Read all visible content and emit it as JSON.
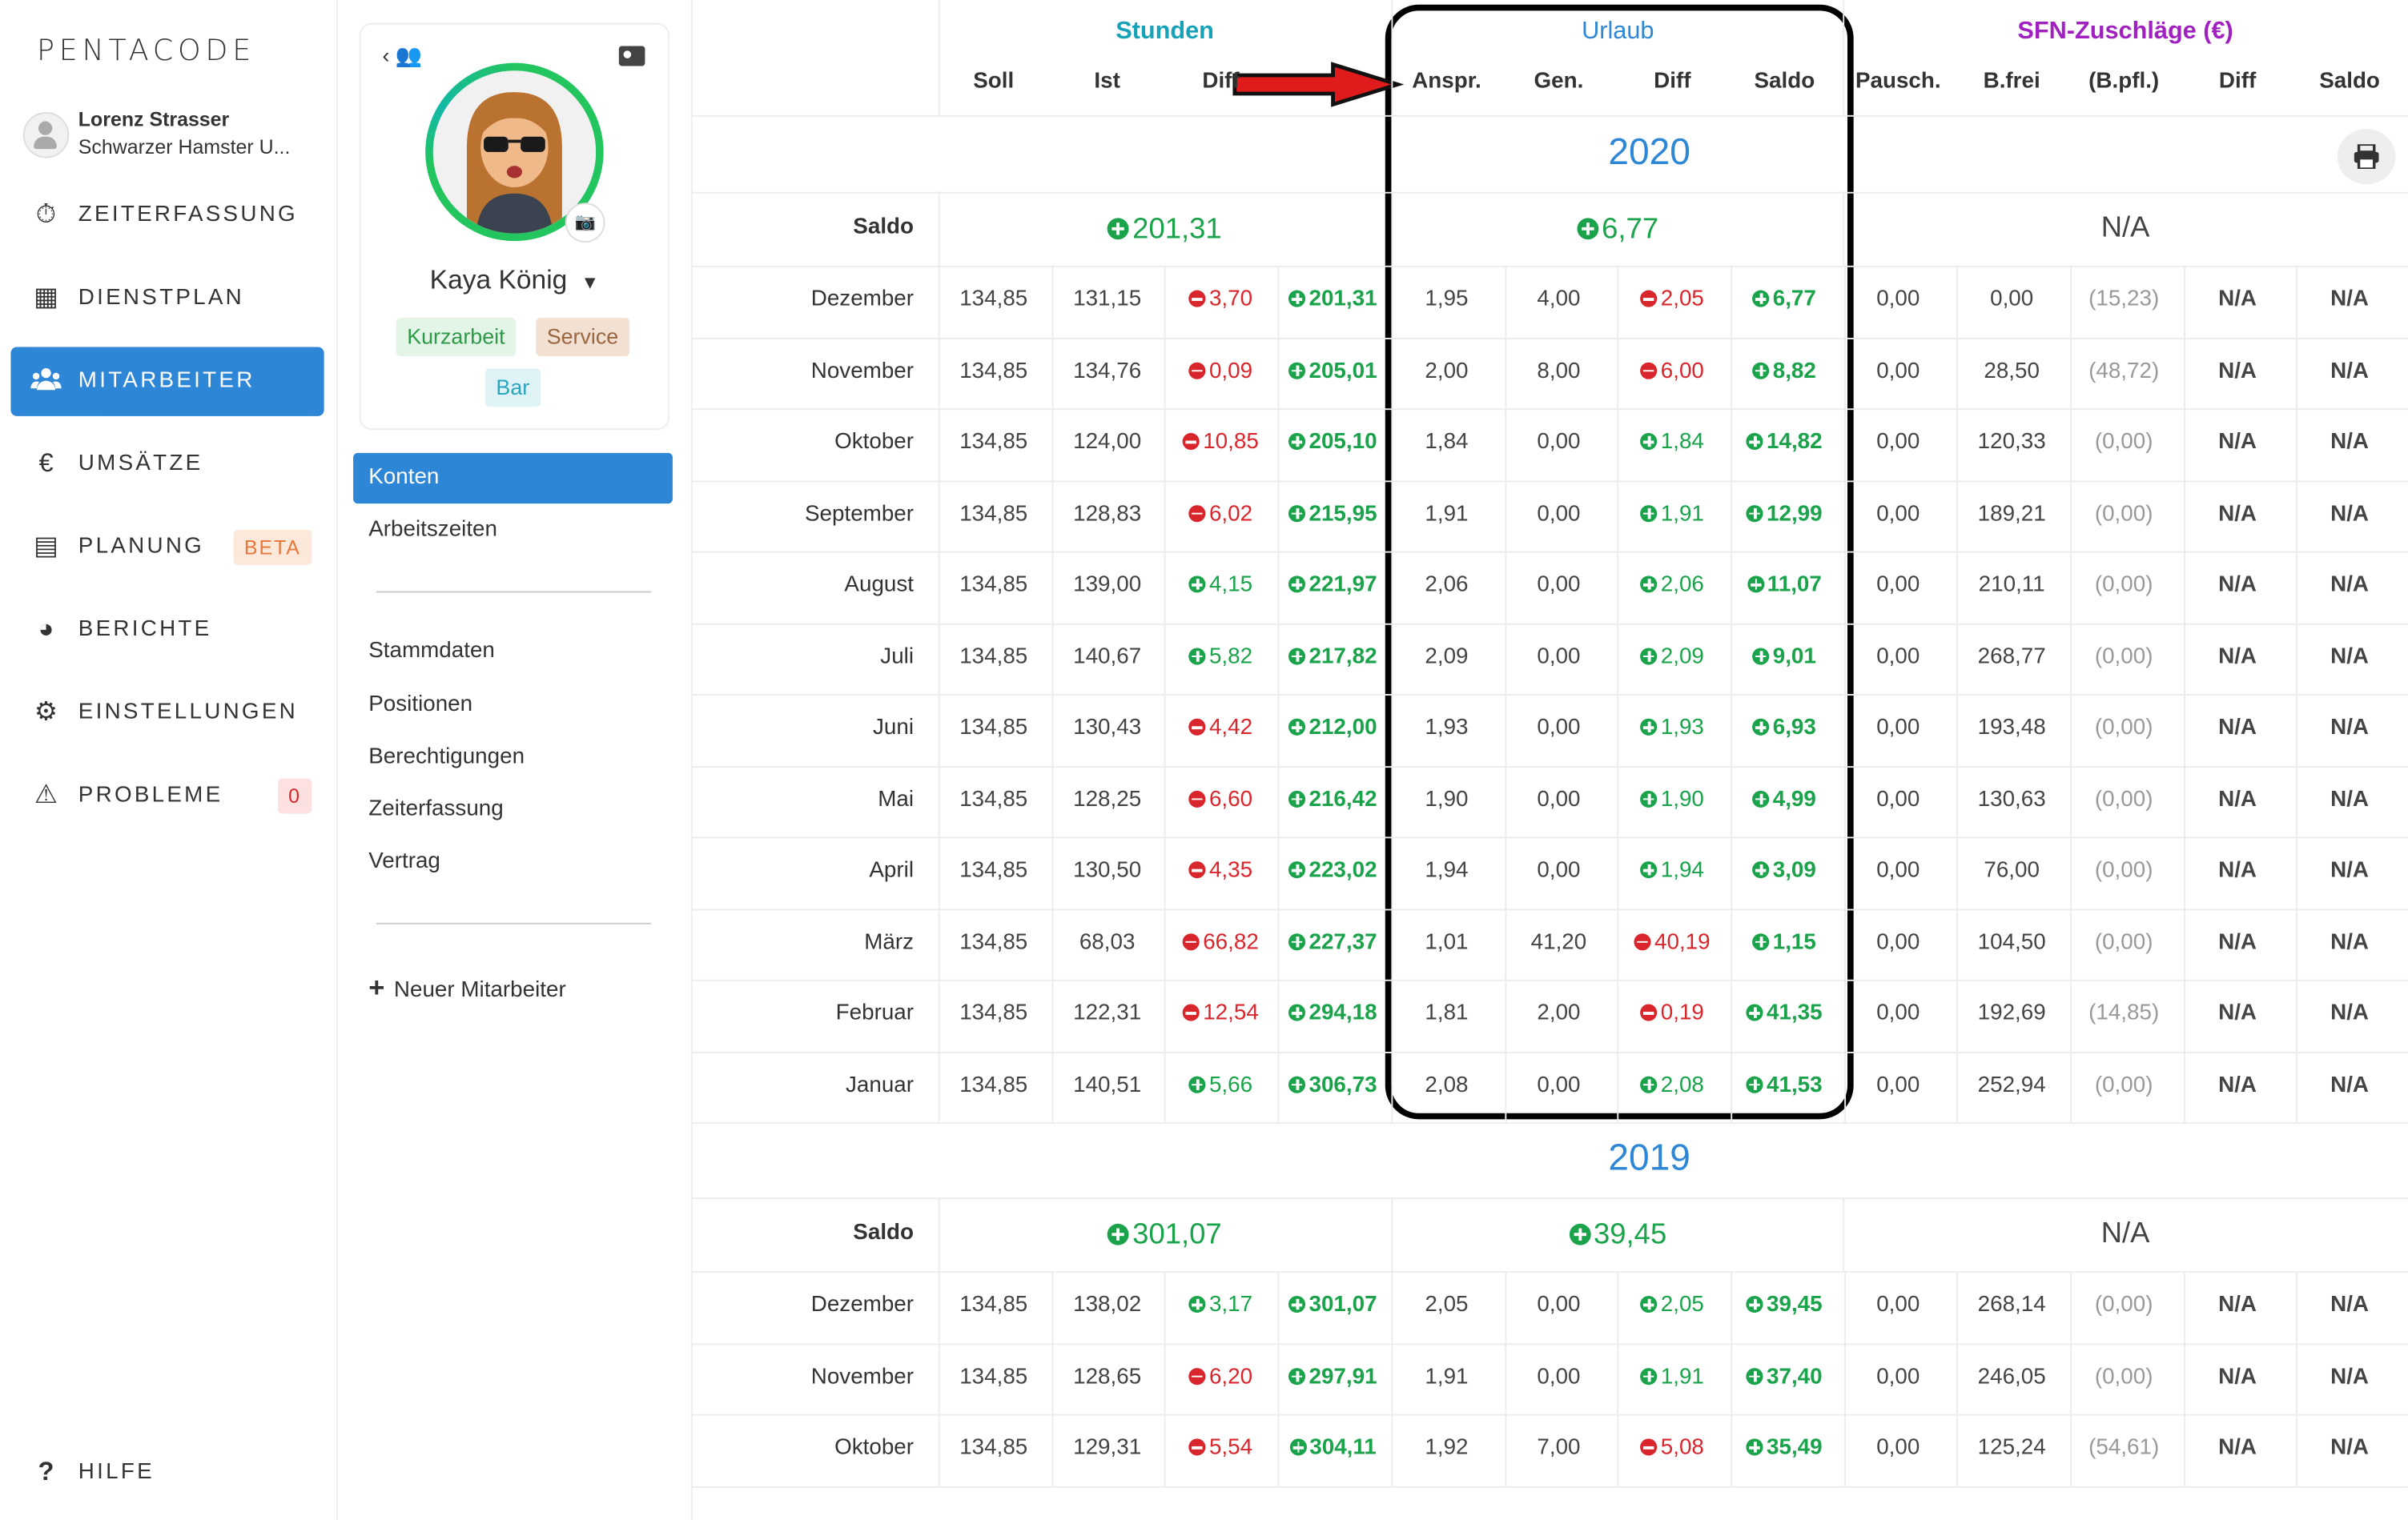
{
  "app": {
    "logo": "PENTACODE"
  },
  "user": {
    "name": "Lorenz Strasser",
    "company": "Schwarzer Hamster U..."
  },
  "nav": {
    "items": [
      {
        "label": "ZEITERFASSUNG",
        "icon": "stopwatch-icon"
      },
      {
        "label": "DIENSTPLAN",
        "icon": "table-icon"
      },
      {
        "label": "MITARBEITER",
        "icon": "users-icon",
        "active": true
      },
      {
        "label": "UMSÄTZE",
        "icon": "euro-icon"
      },
      {
        "label": "PLANUNG",
        "icon": "calendar-icon",
        "badge": "BETA"
      },
      {
        "label": "BERICHTE",
        "icon": "pie-chart-icon"
      },
      {
        "label": "EINSTELLUNGEN",
        "icon": "gear-icon"
      },
      {
        "label": "PROBLEME",
        "icon": "warning-icon",
        "badge": "0"
      }
    ],
    "help": "HILFE"
  },
  "profile": {
    "name": "Kaya König",
    "tags": [
      "Kurzarbeit",
      "Service",
      "Bar"
    ],
    "subnav_top": [
      "Konten",
      "Arbeitszeiten"
    ],
    "subnav_mid": [
      "Stammdaten",
      "Positionen",
      "Berechtigungen",
      "Zeiterfassung",
      "Vertrag"
    ],
    "new_employee": "Neuer Mitarbeiter"
  },
  "table": {
    "groups": {
      "stunden": "Stunden",
      "urlaub": "Urlaub",
      "sfn": "SFN-Zuschläge (€)"
    },
    "headers": [
      "Soll",
      "Ist",
      "Diff",
      "Anspr.",
      "Gen.",
      "Diff",
      "Saldo",
      "Pausch.",
      "B.frei",
      "(B.pfl.)",
      "Diff",
      "Saldo"
    ],
    "saldo_label": "Saldo",
    "years": [
      {
        "year": "2020",
        "saldo_stunden": "201,31",
        "saldo_urlaub": "6,77",
        "saldo_sfn": "N/A",
        "rows": [
          {
            "month": "Dezember",
            "soll": "134,85",
            "ist": "131,15",
            "diff": "3,70",
            "diff_sign": "n",
            "saldo": "201,31",
            "anspr": "1,95",
            "gen": "4,00",
            "udiff": "2,05",
            "udiff_sign": "n",
            "usaldo": "6,77",
            "pausch": "0,00",
            "bfrei": "0,00",
            "bpfl": "(15,23)",
            "sdiff": "N/A",
            "ssaldo": "N/A"
          },
          {
            "month": "November",
            "soll": "134,85",
            "ist": "134,76",
            "diff": "0,09",
            "diff_sign": "n",
            "saldo": "205,01",
            "anspr": "2,00",
            "gen": "8,00",
            "udiff": "6,00",
            "udiff_sign": "n",
            "usaldo": "8,82",
            "pausch": "0,00",
            "bfrei": "28,50",
            "bpfl": "(48,72)",
            "sdiff": "N/A",
            "ssaldo": "N/A"
          },
          {
            "month": "Oktober",
            "soll": "134,85",
            "ist": "124,00",
            "diff": "10,85",
            "diff_sign": "n",
            "saldo": "205,10",
            "anspr": "1,84",
            "gen": "0,00",
            "udiff": "1,84",
            "udiff_sign": "p",
            "usaldo": "14,82",
            "pausch": "0,00",
            "bfrei": "120,33",
            "bpfl": "(0,00)",
            "sdiff": "N/A",
            "ssaldo": "N/A"
          },
          {
            "month": "September",
            "soll": "134,85",
            "ist": "128,83",
            "diff": "6,02",
            "diff_sign": "n",
            "saldo": "215,95",
            "anspr": "1,91",
            "gen": "0,00",
            "udiff": "1,91",
            "udiff_sign": "p",
            "usaldo": "12,99",
            "pausch": "0,00",
            "bfrei": "189,21",
            "bpfl": "(0,00)",
            "sdiff": "N/A",
            "ssaldo": "N/A"
          },
          {
            "month": "August",
            "soll": "134,85",
            "ist": "139,00",
            "diff": "4,15",
            "diff_sign": "p",
            "saldo": "221,97",
            "anspr": "2,06",
            "gen": "0,00",
            "udiff": "2,06",
            "udiff_sign": "p",
            "usaldo": "11,07",
            "pausch": "0,00",
            "bfrei": "210,11",
            "bpfl": "(0,00)",
            "sdiff": "N/A",
            "ssaldo": "N/A"
          },
          {
            "month": "Juli",
            "soll": "134,85",
            "ist": "140,67",
            "diff": "5,82",
            "diff_sign": "p",
            "saldo": "217,82",
            "anspr": "2,09",
            "gen": "0,00",
            "udiff": "2,09",
            "udiff_sign": "p",
            "usaldo": "9,01",
            "pausch": "0,00",
            "bfrei": "268,77",
            "bpfl": "(0,00)",
            "sdiff": "N/A",
            "ssaldo": "N/A"
          },
          {
            "month": "Juni",
            "soll": "134,85",
            "ist": "130,43",
            "diff": "4,42",
            "diff_sign": "n",
            "saldo": "212,00",
            "anspr": "1,93",
            "gen": "0,00",
            "udiff": "1,93",
            "udiff_sign": "p",
            "usaldo": "6,93",
            "pausch": "0,00",
            "bfrei": "193,48",
            "bpfl": "(0,00)",
            "sdiff": "N/A",
            "ssaldo": "N/A"
          },
          {
            "month": "Mai",
            "soll": "134,85",
            "ist": "128,25",
            "diff": "6,60",
            "diff_sign": "n",
            "saldo": "216,42",
            "anspr": "1,90",
            "gen": "0,00",
            "udiff": "1,90",
            "udiff_sign": "p",
            "usaldo": "4,99",
            "pausch": "0,00",
            "bfrei": "130,63",
            "bpfl": "(0,00)",
            "sdiff": "N/A",
            "ssaldo": "N/A"
          },
          {
            "month": "April",
            "soll": "134,85",
            "ist": "130,50",
            "diff": "4,35",
            "diff_sign": "n",
            "saldo": "223,02",
            "anspr": "1,94",
            "gen": "0,00",
            "udiff": "1,94",
            "udiff_sign": "p",
            "usaldo": "3,09",
            "pausch": "0,00",
            "bfrei": "76,00",
            "bpfl": "(0,00)",
            "sdiff": "N/A",
            "ssaldo": "N/A"
          },
          {
            "month": "März",
            "soll": "134,85",
            "ist": "68,03",
            "diff": "66,82",
            "diff_sign": "n",
            "saldo": "227,37",
            "anspr": "1,01",
            "gen": "41,20",
            "udiff": "40,19",
            "udiff_sign": "n",
            "usaldo": "1,15",
            "pausch": "0,00",
            "bfrei": "104,50",
            "bpfl": "(0,00)",
            "sdiff": "N/A",
            "ssaldo": "N/A"
          },
          {
            "month": "Februar",
            "soll": "134,85",
            "ist": "122,31",
            "diff": "12,54",
            "diff_sign": "n",
            "saldo": "294,18",
            "anspr": "1,81",
            "gen": "2,00",
            "udiff": "0,19",
            "udiff_sign": "n",
            "usaldo": "41,35",
            "pausch": "0,00",
            "bfrei": "192,69",
            "bpfl": "(14,85)",
            "sdiff": "N/A",
            "ssaldo": "N/A"
          },
          {
            "month": "Januar",
            "soll": "134,85",
            "ist": "140,51",
            "diff": "5,66",
            "diff_sign": "p",
            "saldo": "306,73",
            "anspr": "2,08",
            "gen": "0,00",
            "udiff": "2,08",
            "udiff_sign": "p",
            "usaldo": "41,53",
            "pausch": "0,00",
            "bfrei": "252,94",
            "bpfl": "(0,00)",
            "sdiff": "N/A",
            "ssaldo": "N/A"
          }
        ]
      },
      {
        "year": "2019",
        "saldo_stunden": "301,07",
        "saldo_urlaub": "39,45",
        "saldo_sfn": "N/A",
        "rows": [
          {
            "month": "Dezember",
            "soll": "134,85",
            "ist": "138,02",
            "diff": "3,17",
            "diff_sign": "p",
            "saldo": "301,07",
            "anspr": "2,05",
            "gen": "0,00",
            "udiff": "2,05",
            "udiff_sign": "p",
            "usaldo": "39,45",
            "pausch": "0,00",
            "bfrei": "268,14",
            "bpfl": "(0,00)",
            "sdiff": "N/A",
            "ssaldo": "N/A"
          },
          {
            "month": "November",
            "soll": "134,85",
            "ist": "128,65",
            "diff": "6,20",
            "diff_sign": "n",
            "saldo": "297,91",
            "anspr": "1,91",
            "gen": "0,00",
            "udiff": "1,91",
            "udiff_sign": "p",
            "usaldo": "37,40",
            "pausch": "0,00",
            "bfrei": "246,05",
            "bpfl": "(0,00)",
            "sdiff": "N/A",
            "ssaldo": "N/A"
          },
          {
            "month": "Oktober",
            "soll": "134,85",
            "ist": "129,31",
            "diff": "5,54",
            "diff_sign": "n",
            "saldo": "304,11",
            "anspr": "1,92",
            "gen": "7,00",
            "udiff": "5,08",
            "udiff_sign": "n",
            "usaldo": "35,49",
            "pausch": "0,00",
            "bfrei": "125,24",
            "bpfl": "(54,61)",
            "sdiff": "N/A",
            "ssaldo": "N/A"
          }
        ]
      }
    ]
  },
  "colors": {
    "accent": "#2d86d6",
    "stunden": "#17a2b8",
    "urlaub": "#2d86d6",
    "sfn": "#a020c0",
    "positive": "#1aa34a",
    "negative": "#d9262c"
  }
}
